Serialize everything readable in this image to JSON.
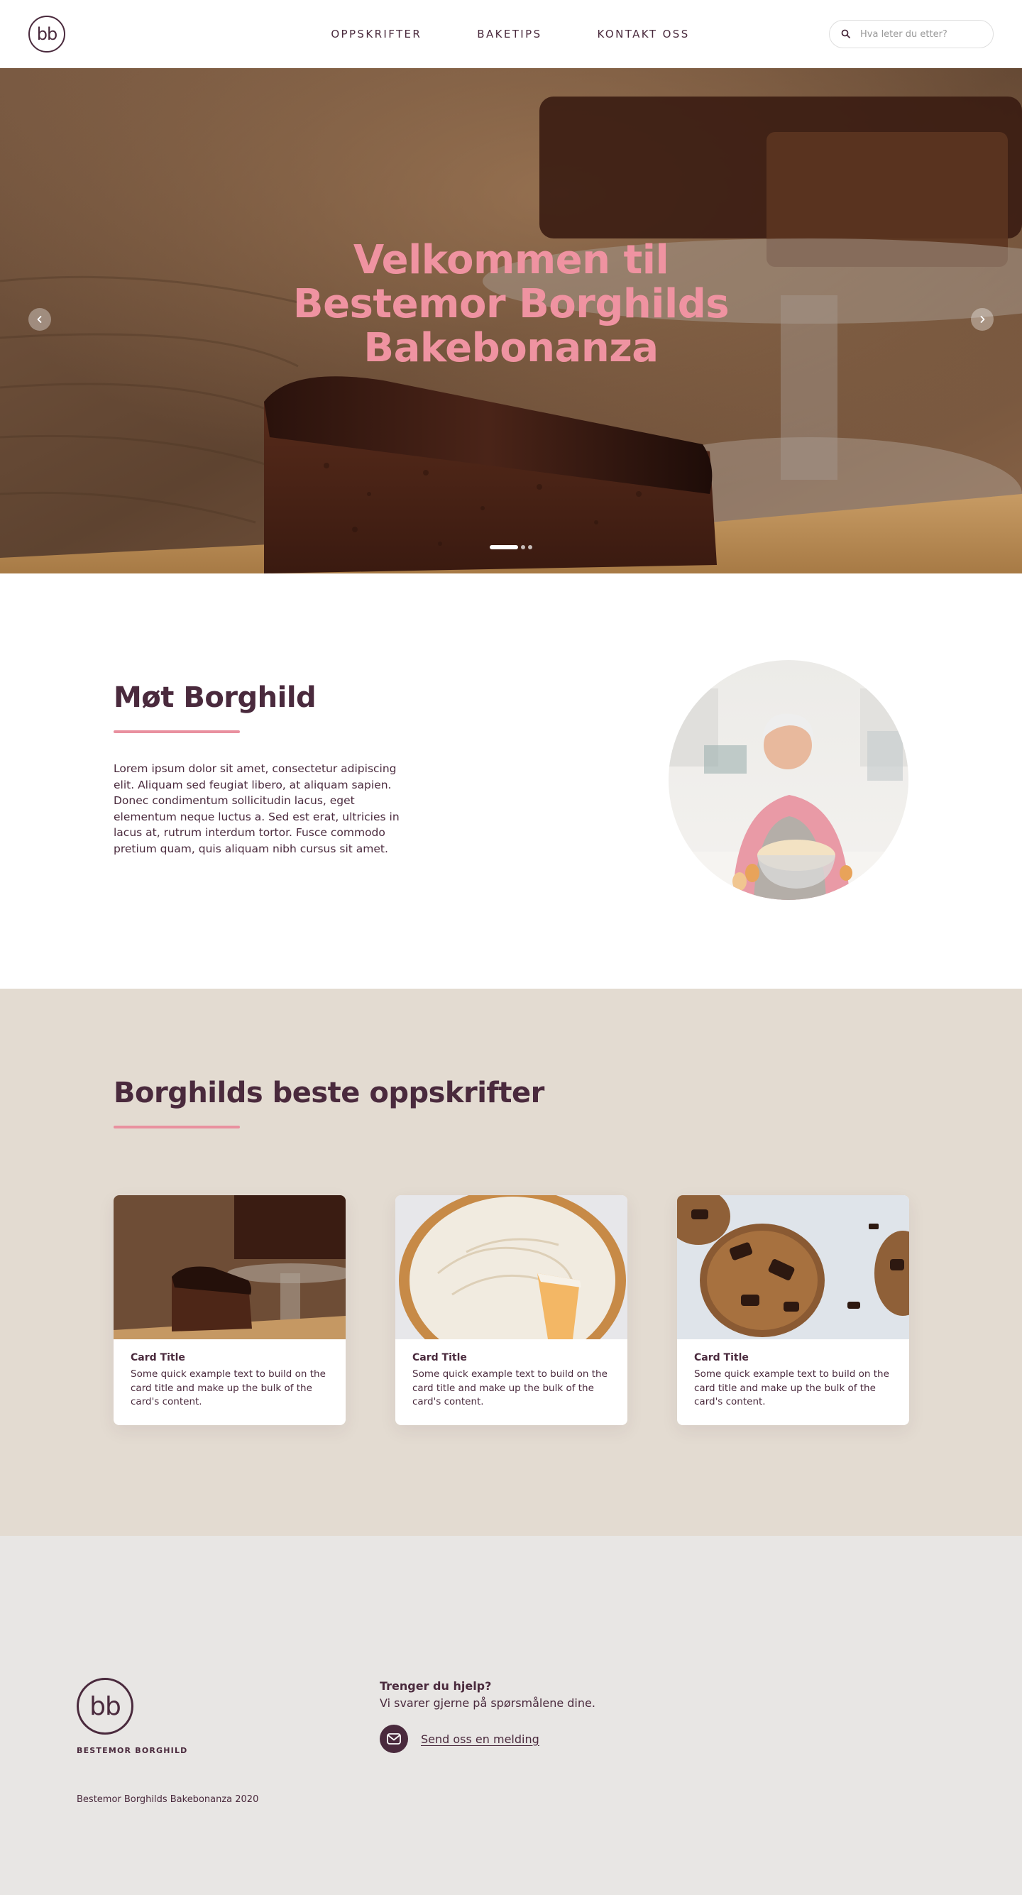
{
  "header": {
    "logo_text": "bb",
    "nav": [
      "OPPSKRIFTER",
      "BAKETIPS",
      "KONTAKT OSS"
    ],
    "search_placeholder": "Hva leter du etter?"
  },
  "hero": {
    "title_lines": [
      "Velkommen til",
      "Bestemor Borghilds",
      "Bakebonanza"
    ],
    "slide_count": 3,
    "active_slide": 1
  },
  "about": {
    "title": "Møt Borghild",
    "text": "Lorem ipsum dolor sit amet, consectetur adipiscing elit. Aliquam sed feugiat libero, at aliquam sapien. Donec condimentum sollicitudin lacus, eget elementum neque luctus a. Sed est erat, ultricies in lacus at, rutrum interdum tortor. Fusce commodo pretium quam, quis aliquam nibh cursus sit amet."
  },
  "recipes": {
    "title": "Borghilds beste oppskrifter",
    "cards": [
      {
        "title": "Card Title",
        "text": "Some quick example text to build on the card title and make up the bulk of the card's content."
      },
      {
        "title": "Card Title",
        "text": "Some quick example text to build on the card title and make up the bulk of the card's content."
      },
      {
        "title": "Card Title",
        "text": "Some quick example text to build on the card title and make up the bulk of the card's content."
      }
    ]
  },
  "footer": {
    "logo_text": "bb",
    "brand": "BESTEMOR BORGHILD",
    "help_title": "Trenger du hjelp?",
    "help_text": "Vi svarer gjerne på spørsmålene dine.",
    "contact_label": "Send oss en melding",
    "copyright": "Bestemor Borghilds Bakebonanza 2020"
  },
  "colors": {
    "plum": "#4a2a3d",
    "pink": "#ef93a1",
    "beige": "#e3dbd1",
    "footer_gray": "#e8e6e4"
  }
}
